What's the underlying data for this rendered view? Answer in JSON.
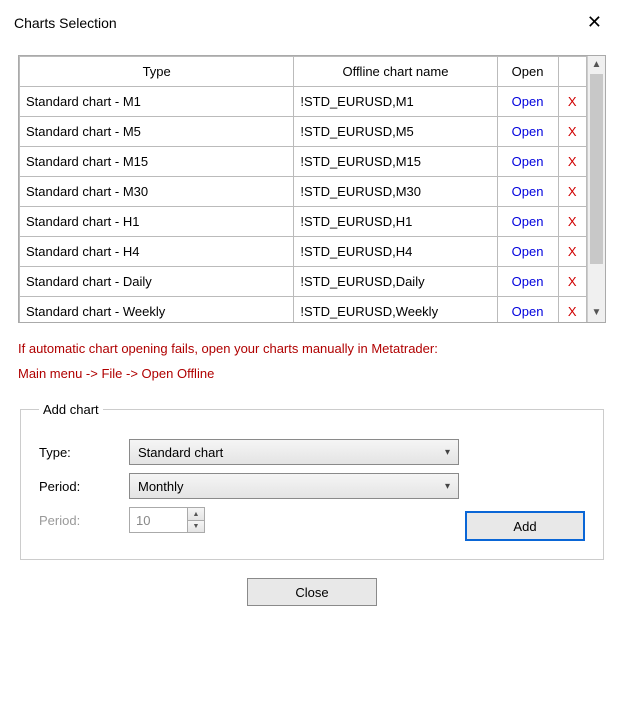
{
  "window": {
    "title": "Charts Selection"
  },
  "table": {
    "headers": {
      "type": "Type",
      "name": "Offline chart name",
      "open": "Open"
    },
    "open_label": "Open",
    "delete_label": "X",
    "rows": [
      {
        "type": "Standard chart - M1",
        "name": "!STD_EURUSD,M1"
      },
      {
        "type": "Standard chart - M5",
        "name": "!STD_EURUSD,M5"
      },
      {
        "type": "Standard chart - M15",
        "name": "!STD_EURUSD,M15"
      },
      {
        "type": "Standard chart - M30",
        "name": "!STD_EURUSD,M30"
      },
      {
        "type": "Standard chart - H1",
        "name": "!STD_EURUSD,H1"
      },
      {
        "type": "Standard chart - H4",
        "name": "!STD_EURUSD,H4"
      },
      {
        "type": "Standard chart - Daily",
        "name": "!STD_EURUSD,Daily"
      },
      {
        "type": "Standard chart - Weekly",
        "name": "!STD_EURUSD,Weekly"
      }
    ]
  },
  "hint": {
    "line1": "If automatic chart opening fails, open your charts manually in Metatrader:",
    "line2": "Main menu -> File -> Open Offline"
  },
  "addchart": {
    "legend": "Add chart",
    "type_label": "Type:",
    "type_value": "Standard chart",
    "period1_label": "Period:",
    "period1_value": "Monthly",
    "period2_label": "Period:",
    "period2_value": "10",
    "add_button": "Add"
  },
  "close_button": "Close"
}
